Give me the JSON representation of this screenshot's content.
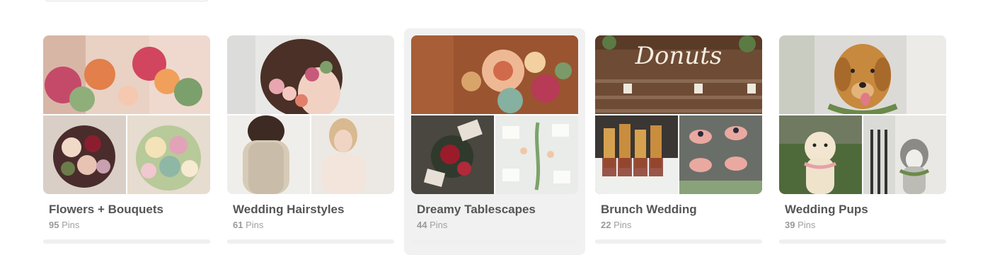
{
  "boards": [
    {
      "title": "Flowers + Bouquets",
      "pin_count": "95",
      "pin_label": "Pins",
      "images": [
        "bridesmaids-bouquets-photo",
        "dark-bouquet-photo",
        "pastel-bouquet-photo"
      ]
    },
    {
      "title": "Wedding Hairstyles",
      "pin_count": "61",
      "pin_label": "Pins",
      "images": [
        "floral-hairpiece-photo",
        "beaded-gown-back-photo",
        "lace-gown-bride-photo"
      ]
    },
    {
      "title": "Dreamy Tablescapes",
      "pin_count": "44",
      "pin_label": "Pins",
      "images": [
        "floral-centerpiece-photo",
        "dark-table-setting-photo",
        "white-table-setting-photo"
      ]
    },
    {
      "title": "Brunch Wedding",
      "pin_count": "22",
      "pin_label": "Pins",
      "images": [
        "donut-wall-photo",
        "french-toast-sticks-photo",
        "champagne-glasses-photo"
      ],
      "sign_text": "Donuts"
    },
    {
      "title": "Wedding Pups",
      "pin_count": "39",
      "pin_label": "Pins",
      "images": [
        "golden-retriever-photo",
        "white-retriever-photo",
        "husky-photo"
      ]
    }
  ],
  "colors": {
    "title": "#555555",
    "meta": "#a0a0a0",
    "hover_bg": "#f1f1f1"
  }
}
